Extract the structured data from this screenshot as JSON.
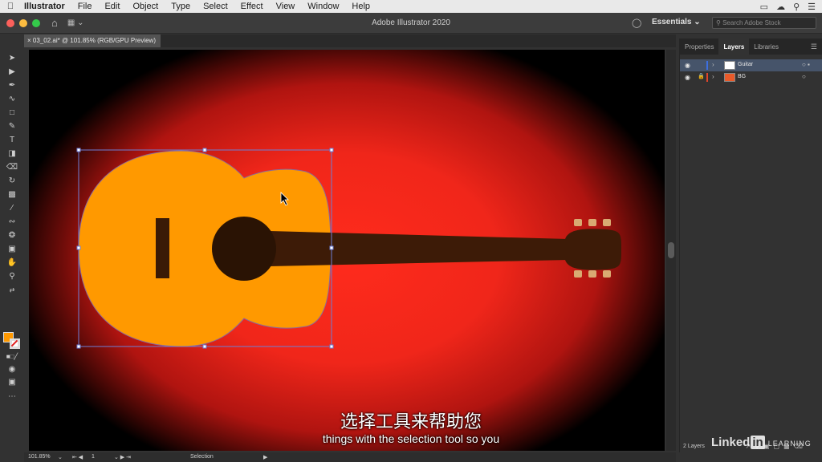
{
  "menubar": {
    "app_name": "Illustrator",
    "items": [
      "File",
      "Edit",
      "Object",
      "Type",
      "Select",
      "Effect",
      "View",
      "Window",
      "Help"
    ]
  },
  "appbar": {
    "window_title": "Adobe Illustrator 2020",
    "workspace": "Essentials",
    "stock_search_placeholder": "Search Adobe Stock"
  },
  "document": {
    "tab_label": "03_02.ai* @ 101.85% (RGB/GPU Preview)"
  },
  "toolbar": {
    "fill_color": "#ff9900",
    "tools": [
      "selection-tool",
      "direct-selection-tool",
      "pen-tool",
      "curvature-tool",
      "rectangle-tool",
      "paintbrush-tool",
      "type-tool",
      "free-transform-tool",
      "eraser-tool",
      "lasso-tool",
      "gradient-tool",
      "eyedropper-tool",
      "shaper-tool",
      "symbol-tool",
      "artboard-tool",
      "hand-tool"
    ]
  },
  "artwork": {
    "background_colors": [
      "#ff2b1c",
      "#000000"
    ],
    "guitar_body_color": "#ff9900",
    "guitar_neck_color": "#3d1b07",
    "sound_hole_color": "#2a1304",
    "tuning_peg_color": "#d9aa72"
  },
  "panel": {
    "tabs": [
      "Properties",
      "Layers",
      "Libraries"
    ],
    "active_tab": "Layers",
    "layers": [
      {
        "name": "Guitar",
        "color": "#3d6fe0",
        "selected": true,
        "locked": false
      },
      {
        "name": "BG",
        "color": "#e0452a",
        "selected": false,
        "locked": true
      }
    ],
    "footer_count": "2 Layers"
  },
  "statusbar": {
    "zoom": "101.85%",
    "artboard_number": "1",
    "tool_name": "Selection"
  },
  "subtitles": {
    "chinese": "选择工具来帮助您",
    "english": "things with the selection tool so you"
  },
  "watermark": {
    "linked": "Linked",
    "in": "in",
    "learning": "LEARNING"
  }
}
